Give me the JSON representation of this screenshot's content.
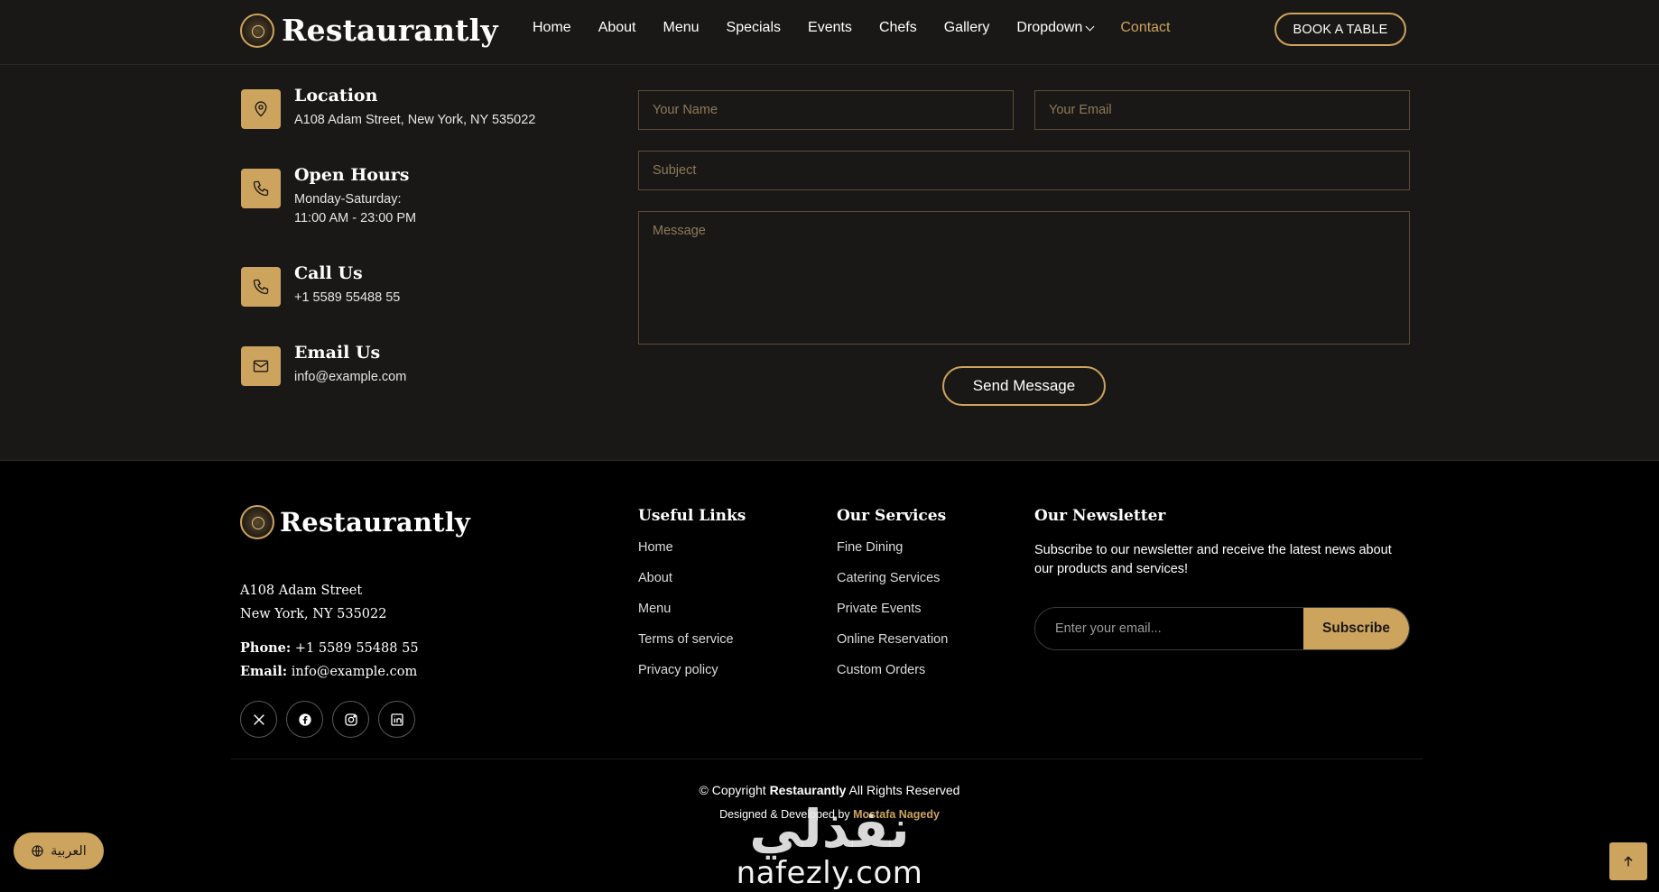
{
  "brand": {
    "name": "Restaurantly"
  },
  "nav": {
    "items": [
      {
        "label": "Home"
      },
      {
        "label": "About"
      },
      {
        "label": "Menu"
      },
      {
        "label": "Specials"
      },
      {
        "label": "Events"
      },
      {
        "label": "Chefs"
      },
      {
        "label": "Gallery"
      },
      {
        "label": "Dropdown"
      },
      {
        "label": "Contact"
      }
    ],
    "active": "Contact",
    "book_label": "BOOK A TABLE"
  },
  "contact_info": {
    "location": {
      "title": "Location",
      "line1": "A108 Adam Street, New York, NY 535022"
    },
    "hours": {
      "title": "Open Hours",
      "line1": "Monday-Saturday:",
      "line2": "11:00 AM - 23:00 PM"
    },
    "call": {
      "title": "Call Us",
      "line1": "+1 5589 55488 55"
    },
    "email": {
      "title": "Email Us",
      "line1": "info@example.com"
    }
  },
  "contact_form": {
    "name_placeholder": "Your Name",
    "email_placeholder": "Your Email",
    "subject_placeholder": "Subject",
    "message_placeholder": "Message",
    "send_label": "Send Message"
  },
  "footer": {
    "address_line1": "A108 Adam Street",
    "address_line2": "New York, NY 535022",
    "phone_label": "Phone:",
    "phone_value": " +1 5589 55488 55",
    "email_label": "Email:",
    "email_value": " info@example.com",
    "socials": [
      "x-icon",
      "facebook-icon",
      "instagram-icon",
      "linkedin-icon"
    ],
    "useful_links": {
      "title": "Useful Links",
      "items": [
        "Home",
        "About",
        "Menu",
        "Terms of service",
        "Privacy policy"
      ]
    },
    "services": {
      "title": "Our Services",
      "items": [
        "Fine Dining",
        "Catering Services",
        "Private Events",
        "Online Reservation",
        "Custom Orders"
      ]
    },
    "newsletter": {
      "title": "Our Newsletter",
      "text": "Subscribe to our newsletter and receive the latest news about our products and services!",
      "placeholder": "Enter your email...",
      "button": "Subscribe"
    },
    "copyright_prefix": "© Copyright ",
    "copyright_brand": "Restaurantly",
    "copyright_suffix": " All Rights Reserved",
    "credits_prefix": "Designed & Developed by ",
    "credits_name": "Mostafa Nagedy"
  },
  "watermark": {
    "arabic": "نفذلي",
    "latin": "nafezly.com"
  },
  "language_button": {
    "label": "العربية"
  },
  "colors": {
    "accent": "#cda45e",
    "section_bg": "#1a1816",
    "footer_bg": "#000000"
  }
}
